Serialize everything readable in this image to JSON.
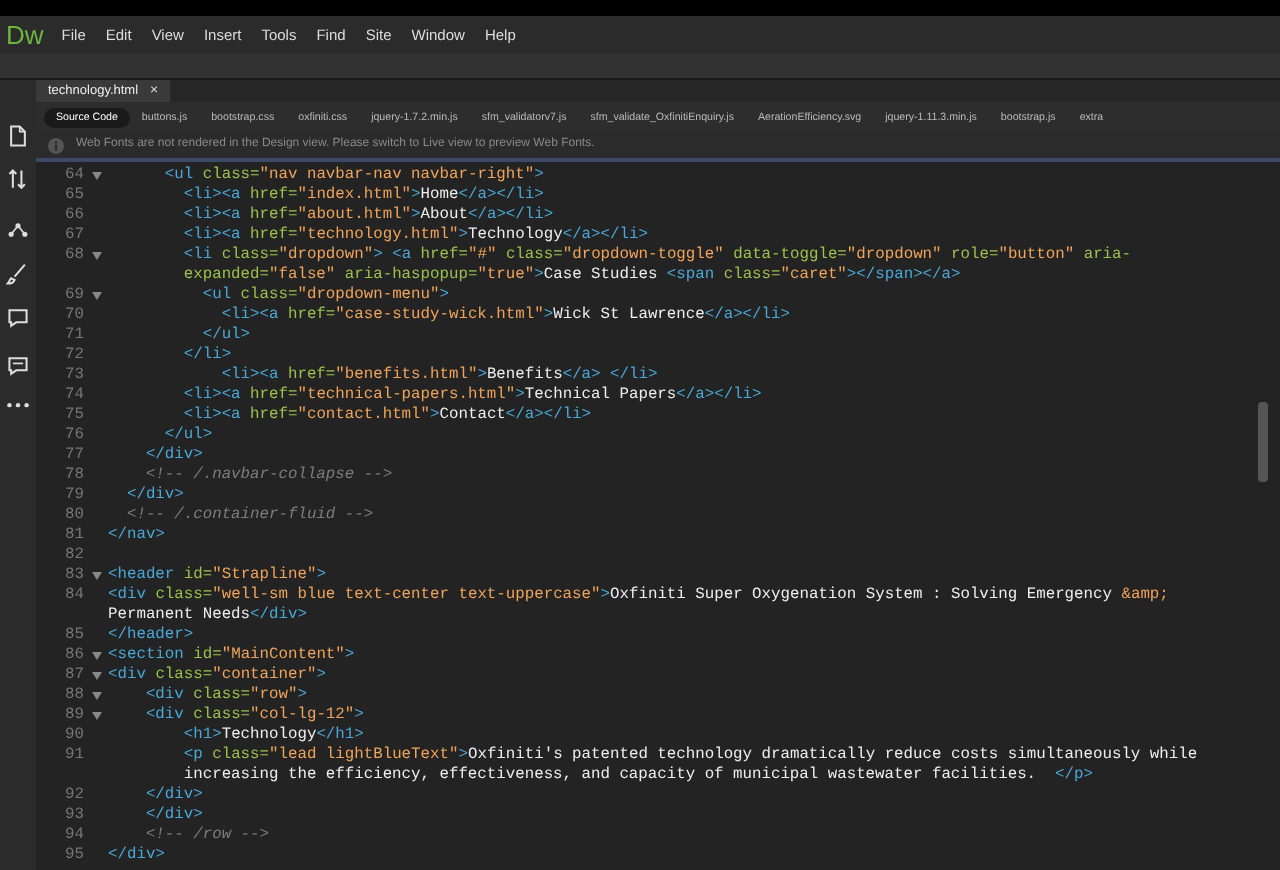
{
  "app": {
    "logo": "Dw",
    "menu": [
      "File",
      "Edit",
      "View",
      "Insert",
      "Tools",
      "Find",
      "Site",
      "Window",
      "Help"
    ]
  },
  "document_tab": {
    "title": "technology.html",
    "close": "×"
  },
  "related_files": [
    {
      "label": "Source Code",
      "selected": true
    },
    {
      "label": "buttons.js",
      "selected": false
    },
    {
      "label": "bootstrap.css",
      "selected": false
    },
    {
      "label": "oxfiniti.css",
      "selected": false
    },
    {
      "label": "jquery-1.7.2.min.js",
      "selected": false
    },
    {
      "label": "sfm_validatorv7.js",
      "selected": false
    },
    {
      "label": "sfm_validate_OxfinitiEnquiry.js",
      "selected": false
    },
    {
      "label": "AerationEfficiency.svg",
      "selected": false
    },
    {
      "label": "jquery-1.11.3.min.js",
      "selected": false
    },
    {
      "label": "bootstrap.js",
      "selected": false
    },
    {
      "label": "extra",
      "selected": false
    }
  ],
  "info_bar": {
    "message": "Web Fonts are not rendered in the Design view. Please switch to Live view to preview Web Fonts."
  },
  "code_lines": [
    {
      "number": "64",
      "foldable": true,
      "code": [
        {
          "kind": "tag",
          "text": "      <ul"
        },
        {
          "kind": "attr",
          "text": " class="
        },
        {
          "kind": "string",
          "text": "\"nav navbar-nav navbar-right\""
        },
        {
          "kind": "tag",
          "text": ">"
        }
      ]
    },
    {
      "number": "65",
      "foldable": false,
      "code": [
        {
          "kind": "tag",
          "text": "        <li><a"
        },
        {
          "kind": "attr",
          "text": " href="
        },
        {
          "kind": "string",
          "text": "\"index.html\""
        },
        {
          "kind": "tag",
          "text": ">"
        },
        {
          "kind": "text",
          "text": "Home"
        },
        {
          "kind": "tag",
          "text": "</a></li>"
        }
      ]
    },
    {
      "number": "66",
      "foldable": false,
      "code": [
        {
          "kind": "tag",
          "text": "        <li><a"
        },
        {
          "kind": "attr",
          "text": " href="
        },
        {
          "kind": "string",
          "text": "\"about.html\""
        },
        {
          "kind": "tag",
          "text": ">"
        },
        {
          "kind": "text",
          "text": "About"
        },
        {
          "kind": "tag",
          "text": "</a></li>"
        }
      ]
    },
    {
      "number": "67",
      "foldable": false,
      "code": [
        {
          "kind": "tag",
          "text": "        <li><a"
        },
        {
          "kind": "attr",
          "text": " href="
        },
        {
          "kind": "string",
          "text": "\"technology.html\""
        },
        {
          "kind": "tag",
          "text": ">"
        },
        {
          "kind": "text",
          "text": "Technology"
        },
        {
          "kind": "tag",
          "text": "</a></li>"
        }
      ]
    },
    {
      "number": "68",
      "foldable": true,
      "code": [
        {
          "kind": "tag",
          "text": "        <li"
        },
        {
          "kind": "attr",
          "text": " class="
        },
        {
          "kind": "string",
          "text": "\"dropdown\""
        },
        {
          "kind": "tag",
          "text": "> <a"
        },
        {
          "kind": "attr",
          "text": " href="
        },
        {
          "kind": "string",
          "text": "\"#\""
        },
        {
          "kind": "attr",
          "text": " class="
        },
        {
          "kind": "string",
          "text": "\"dropdown-toggle\""
        },
        {
          "kind": "attr",
          "text": " data-toggle="
        },
        {
          "kind": "string",
          "text": "\"dropdown\""
        },
        {
          "kind": "attr",
          "text": " role="
        },
        {
          "kind": "string",
          "text": "\"button\""
        },
        {
          "kind": "attr",
          "text": " aria-"
        }
      ],
      "continuation": [
        {
          "kind": "attr",
          "text": "        expanded="
        },
        {
          "kind": "string",
          "text": "\"false\""
        },
        {
          "kind": "attr",
          "text": " aria-haspopup="
        },
        {
          "kind": "string",
          "text": "\"true\""
        },
        {
          "kind": "tag",
          "text": ">"
        },
        {
          "kind": "text",
          "text": "Case Studies "
        },
        {
          "kind": "tag",
          "text": "<span"
        },
        {
          "kind": "attr",
          "text": " class="
        },
        {
          "kind": "string",
          "text": "\"caret\""
        },
        {
          "kind": "tag",
          "text": "></span></a>"
        }
      ]
    },
    {
      "number": "69",
      "foldable": true,
      "code": [
        {
          "kind": "tag",
          "text": "          <ul"
        },
        {
          "kind": "attr",
          "text": " class="
        },
        {
          "kind": "string",
          "text": "\"dropdown-menu\""
        },
        {
          "kind": "tag",
          "text": ">"
        }
      ]
    },
    {
      "number": "70",
      "foldable": false,
      "code": [
        {
          "kind": "tag",
          "text": "            <li><a"
        },
        {
          "kind": "attr",
          "text": " href="
        },
        {
          "kind": "string",
          "text": "\"case-study-wick.html\""
        },
        {
          "kind": "tag",
          "text": ">"
        },
        {
          "kind": "text",
          "text": "Wick St Lawrence"
        },
        {
          "kind": "tag",
          "text": "</a></li>"
        }
      ]
    },
    {
      "number": "71",
      "foldable": false,
      "code": [
        {
          "kind": "tag",
          "text": "          </ul>"
        }
      ]
    },
    {
      "number": "72",
      "foldable": false,
      "code": [
        {
          "kind": "tag",
          "text": "        </li>"
        }
      ]
    },
    {
      "number": "73",
      "foldable": false,
      "code": [
        {
          "kind": "tag",
          "text": "            <li><a"
        },
        {
          "kind": "attr",
          "text": " href="
        },
        {
          "kind": "string",
          "text": "\"benefits.html\""
        },
        {
          "kind": "tag",
          "text": ">"
        },
        {
          "kind": "text",
          "text": "Benefits"
        },
        {
          "kind": "tag",
          "text": "</a> </li>"
        }
      ]
    },
    {
      "number": "74",
      "foldable": false,
      "code": [
        {
          "kind": "tag",
          "text": "        <li><a"
        },
        {
          "kind": "attr",
          "text": " href="
        },
        {
          "kind": "string",
          "text": "\"technical-papers.html\""
        },
        {
          "kind": "tag",
          "text": ">"
        },
        {
          "kind": "text",
          "text": "Technical Papers"
        },
        {
          "kind": "tag",
          "text": "</a></li>"
        }
      ]
    },
    {
      "number": "75",
      "foldable": false,
      "code": [
        {
          "kind": "tag",
          "text": "        <li><a"
        },
        {
          "kind": "attr",
          "text": " href="
        },
        {
          "kind": "string",
          "text": "\"contact.html\""
        },
        {
          "kind": "tag",
          "text": ">"
        },
        {
          "kind": "text",
          "text": "Contact"
        },
        {
          "kind": "tag",
          "text": "</a></li>"
        }
      ]
    },
    {
      "number": "76",
      "foldable": false,
      "code": [
        {
          "kind": "tag",
          "text": "      </ul>"
        }
      ]
    },
    {
      "number": "77",
      "foldable": false,
      "code": [
        {
          "kind": "tag",
          "text": "    </div>"
        }
      ]
    },
    {
      "number": "78",
      "foldable": false,
      "code": [
        {
          "kind": "comment",
          "text": "    <!-- /.navbar-collapse -->"
        }
      ]
    },
    {
      "number": "79",
      "foldable": false,
      "code": [
        {
          "kind": "tag",
          "text": "  </div>"
        }
      ]
    },
    {
      "number": "80",
      "foldable": false,
      "code": [
        {
          "kind": "comment",
          "text": "  <!-- /.container-fluid -->"
        }
      ]
    },
    {
      "number": "81",
      "foldable": false,
      "code": [
        {
          "kind": "tag",
          "text": "</nav>"
        }
      ]
    },
    {
      "number": "82",
      "foldable": false
    },
    {
      "number": "83",
      "foldable": true,
      "code": [
        {
          "kind": "tag",
          "text": "<header"
        },
        {
          "kind": "attr",
          "text": " id="
        },
        {
          "kind": "string",
          "text": "\"Strapline\""
        },
        {
          "kind": "tag",
          "text": ">"
        }
      ]
    },
    {
      "number": "84",
      "foldable": false,
      "code": [
        {
          "kind": "tag",
          "text": "<div"
        },
        {
          "kind": "attr",
          "text": " class="
        },
        {
          "kind": "string",
          "text": "\"well-sm blue text-center text-uppercase\""
        },
        {
          "kind": "tag",
          "text": ">"
        },
        {
          "kind": "text",
          "text": "Oxfiniti Super Oxygenation System : Solving Emergency "
        },
        {
          "kind": "entity",
          "text": "&amp;"
        }
      ],
      "continuation": [
        {
          "kind": "text",
          "text": "Permanent Needs"
        },
        {
          "kind": "tag",
          "text": "</div>"
        }
      ]
    },
    {
      "number": "85",
      "foldable": false,
      "code": [
        {
          "kind": "tag",
          "text": "</header>"
        }
      ]
    },
    {
      "number": "86",
      "foldable": true,
      "code": [
        {
          "kind": "tag",
          "text": "<section"
        },
        {
          "kind": "attr",
          "text": " id="
        },
        {
          "kind": "string",
          "text": "\"MainContent\""
        },
        {
          "kind": "tag",
          "text": ">"
        }
      ]
    },
    {
      "number": "87",
      "foldable": true,
      "code": [
        {
          "kind": "tag",
          "text": "<div"
        },
        {
          "kind": "attr",
          "text": " class="
        },
        {
          "kind": "string",
          "text": "\"container\""
        },
        {
          "kind": "tag",
          "text": ">"
        }
      ]
    },
    {
      "number": "88",
      "foldable": true,
      "code": [
        {
          "kind": "tag",
          "text": "    <div"
        },
        {
          "kind": "attr",
          "text": " class="
        },
        {
          "kind": "string",
          "text": "\"row\""
        },
        {
          "kind": "tag",
          "text": ">"
        }
      ]
    },
    {
      "number": "89",
      "foldable": true,
      "code": [
        {
          "kind": "tag",
          "text": "    <div"
        },
        {
          "kind": "attr",
          "text": " class="
        },
        {
          "kind": "string",
          "text": "\"col-lg-12\""
        },
        {
          "kind": "tag",
          "text": ">"
        }
      ]
    },
    {
      "number": "90",
      "foldable": false,
      "code": [
        {
          "kind": "tag",
          "text": "        <h1>"
        },
        {
          "kind": "text",
          "text": "Technology"
        },
        {
          "kind": "tag",
          "text": "</h1>"
        }
      ]
    },
    {
      "number": "91",
      "foldable": false,
      "code": [
        {
          "kind": "tag",
          "text": "        <p"
        },
        {
          "kind": "attr",
          "text": " class="
        },
        {
          "kind": "string",
          "text": "\"lead lightBlueText\""
        },
        {
          "kind": "tag",
          "text": ">"
        },
        {
          "kind": "text",
          "text": "Oxfiniti's patented technology dramatically reduce costs simultaneously while"
        }
      ],
      "continuation": [
        {
          "kind": "text",
          "text": "        increasing the efficiency, effectiveness, and capacity of municipal wastewater facilities.  "
        },
        {
          "kind": "tag",
          "text": "</p>"
        }
      ]
    },
    {
      "number": "92",
      "foldable": false,
      "code": [
        {
          "kind": "tag",
          "text": "    </div>"
        }
      ]
    },
    {
      "number": "93",
      "foldable": false,
      "code": [
        {
          "kind": "tag",
          "text": "    </div>"
        }
      ]
    },
    {
      "number": "94",
      "foldable": false,
      "code": [
        {
          "kind": "comment",
          "text": "    <!-- /row -->"
        }
      ]
    },
    {
      "number": "95",
      "foldable": false,
      "code": [
        {
          "kind": "tag",
          "text": "</div>"
        }
      ]
    }
  ]
}
